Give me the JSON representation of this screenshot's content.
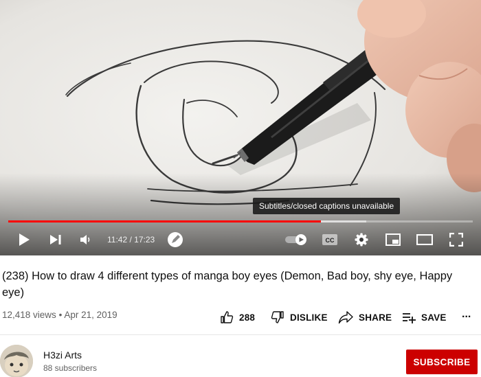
{
  "player": {
    "caption_tooltip": "Subtitles/closed captions unavailable",
    "current_time": "11:42",
    "duration": "17:23",
    "time_separator": "/",
    "progress_fraction": 0.673,
    "buffered_fraction": 0.77,
    "progress_color": "#ff0000",
    "cc_label": "CC",
    "icons": [
      "play-icon",
      "next-icon",
      "volume-icon",
      "autoplay-toggle-icon",
      "cc-icon",
      "gear-icon",
      "miniplayer-icon",
      "theater-icon",
      "fullscreen-icon"
    ]
  },
  "video": {
    "title": "(238) How to draw 4 different types of manga boy eyes (Demon, Bad boy, shy eye, Happy eye)",
    "views": "12,418 views",
    "separator": "•",
    "date": "Apr 21, 2019"
  },
  "actions": {
    "like_count": "288",
    "dislike_label": "DISLIKE",
    "share_label": "SHARE",
    "save_label": "SAVE",
    "more_label": "..."
  },
  "channel": {
    "name": "H3zi Arts",
    "subscribers": "88 subscribers",
    "subscribe_label": "SUBSCRIBE",
    "subscribe_color": "#cc0000"
  }
}
